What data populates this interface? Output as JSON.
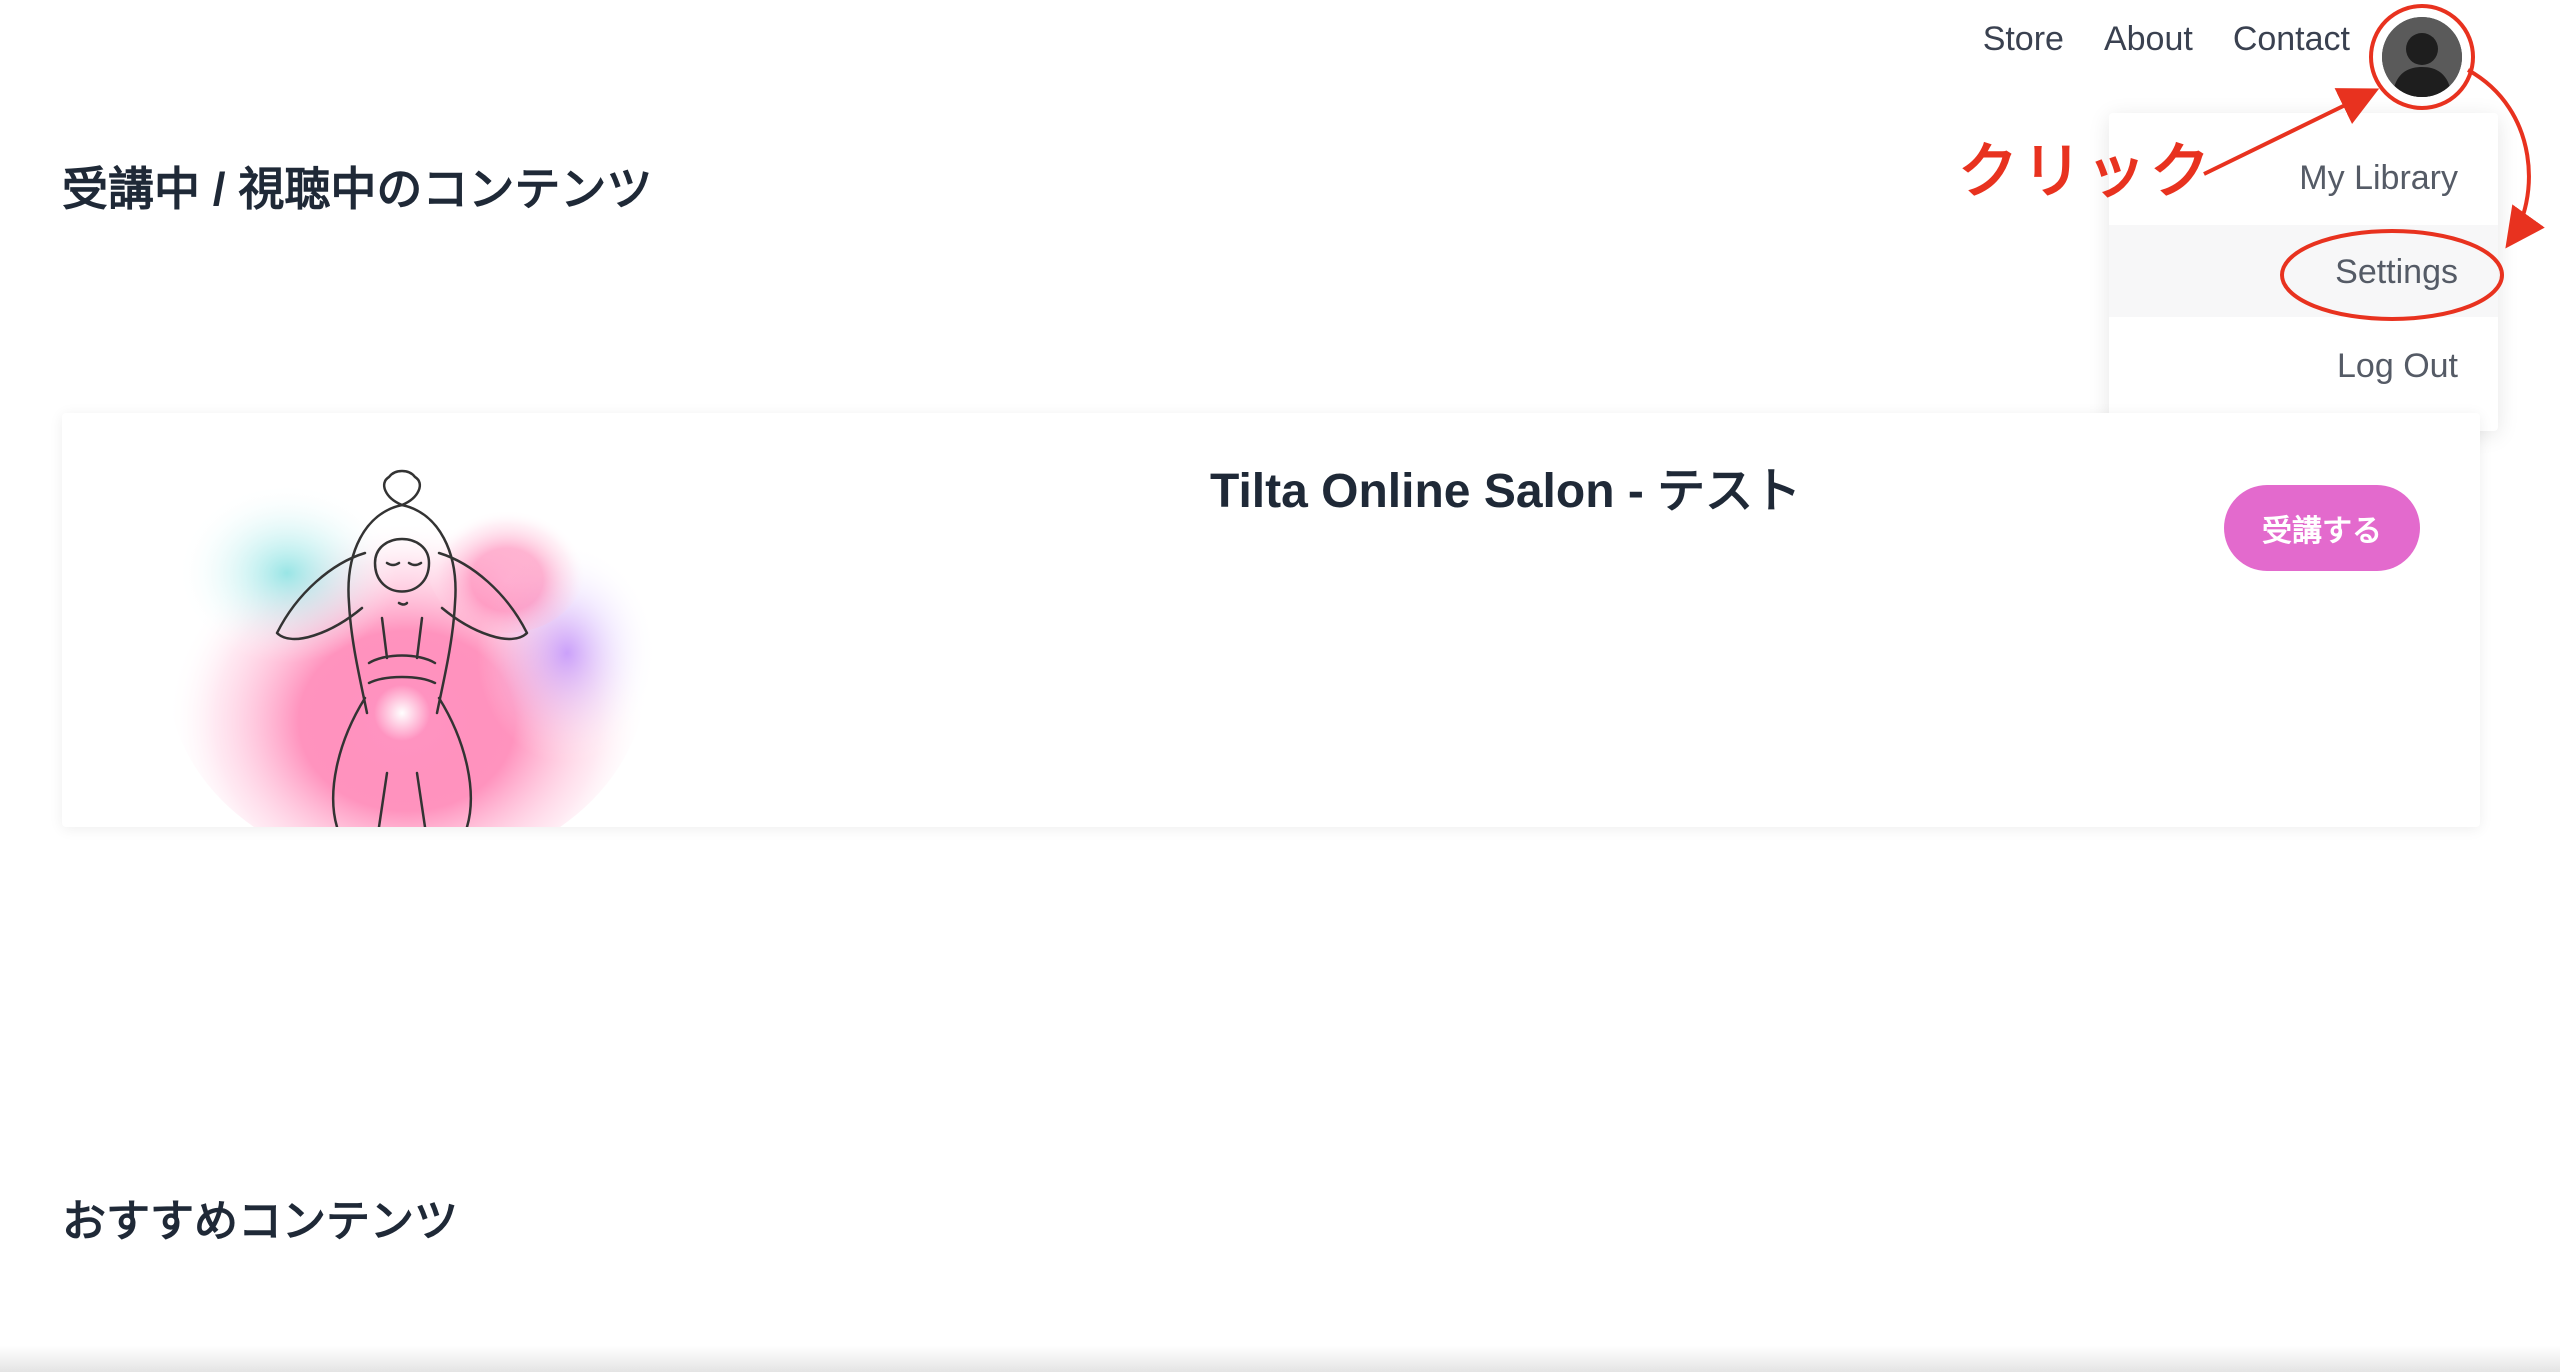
{
  "nav": {
    "links": [
      "Store",
      "About",
      "Contact"
    ]
  },
  "dropdown": {
    "items": [
      "My Library",
      "Settings",
      "Log Out"
    ]
  },
  "main": {
    "enrolled_heading": "受講中 / 視聴中のコンテンツ",
    "recommended_heading": "おすすめコンテンツ"
  },
  "course": {
    "title": "Tilta Online Salon - テスト",
    "button_label": "受講する"
  },
  "annotation": {
    "label": "クリック",
    "color": "#e8321f"
  },
  "colors": {
    "accent_button": "#e36acd",
    "heading_text": "#1f2937"
  }
}
